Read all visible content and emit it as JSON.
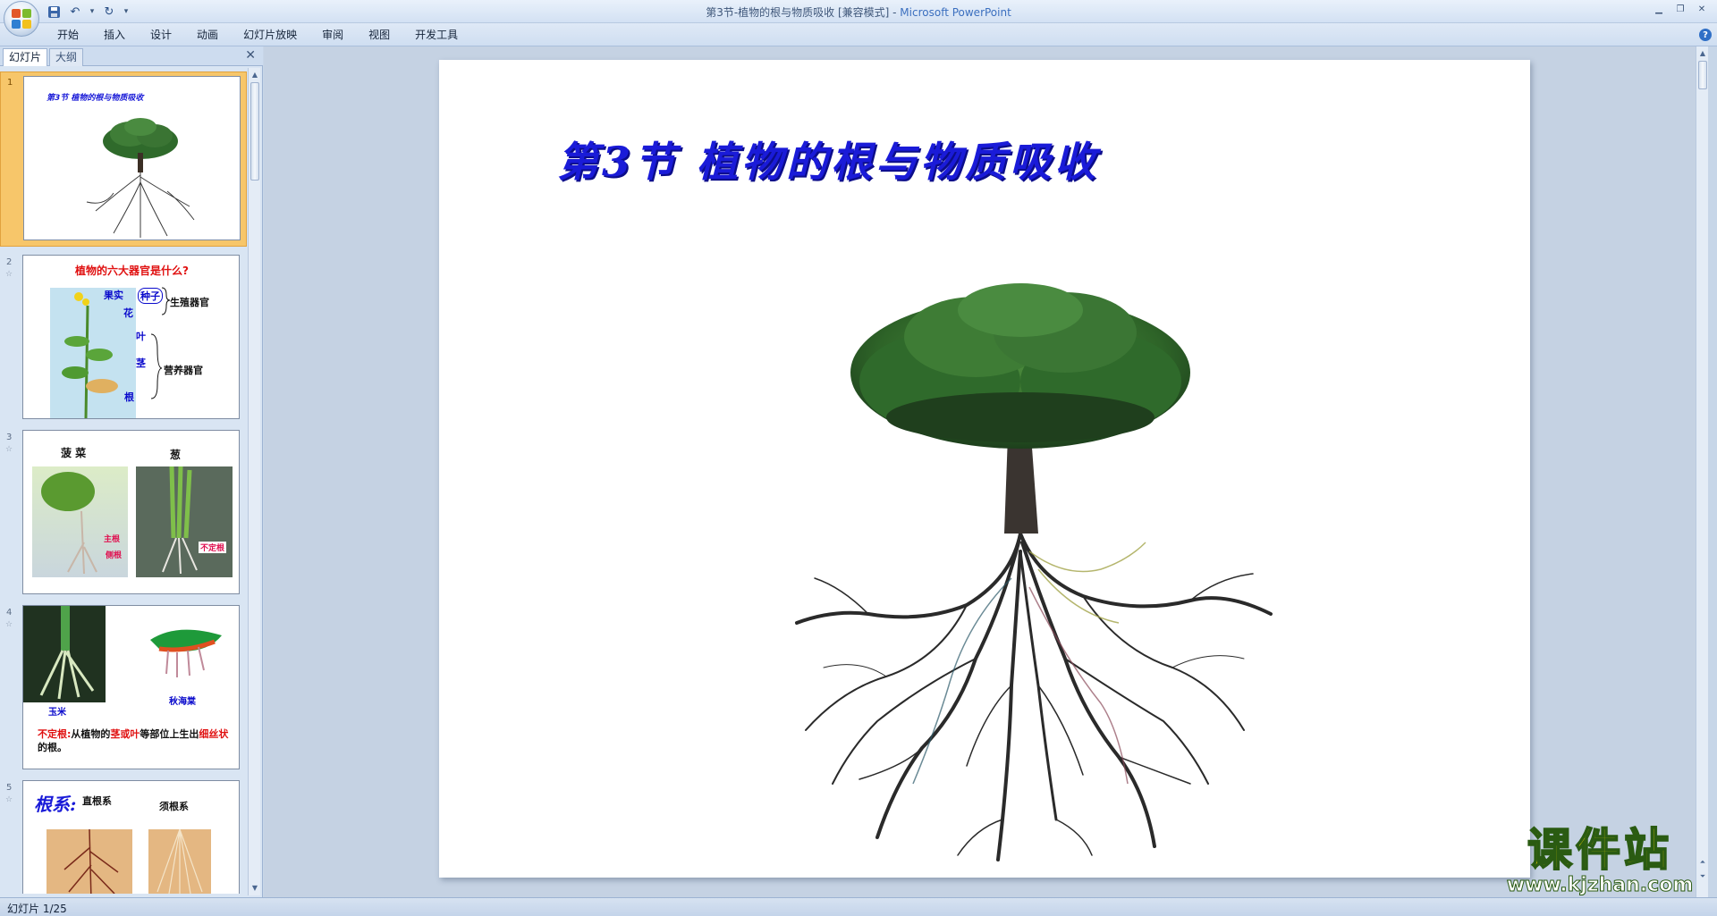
{
  "window": {
    "title_doc": "第3节-植物的根与物质吸收 [兼容模式] - ",
    "title_app": "Microsoft PowerPoint"
  },
  "ribbon": {
    "tabs": [
      "开始",
      "插入",
      "设计",
      "动画",
      "幻灯片放映",
      "审阅",
      "视图",
      "开发工具"
    ]
  },
  "left_pane": {
    "tabs": [
      "幻灯片",
      "大纲"
    ],
    "thumbnails": [
      {
        "num": "1",
        "title": "第3节 植物的根与物质吸收"
      },
      {
        "num": "2",
        "title": "植物的六大器官是什么?",
        "labels": [
          "果实",
          "种子",
          "花",
          "生殖器官",
          "叶",
          "茎",
          "营养器官",
          "根"
        ]
      },
      {
        "num": "3",
        "labels": [
          "菠 菜",
          "葱",
          "主根",
          "侧根",
          "不定根"
        ]
      },
      {
        "num": "4",
        "labels": [
          "玉米",
          "秋海棠"
        ],
        "caption_parts": [
          "不定根:",
          "从植物的",
          "茎或叶",
          "等部位上生出",
          "细丝状",
          "的根。"
        ]
      },
      {
        "num": "5",
        "labels": [
          "根系:",
          "直根系",
          "须根系"
        ]
      }
    ]
  },
  "slide": {
    "title": "第3节 植物的根与物质吸收"
  },
  "watermark": {
    "main": "课件站",
    "url": "www.kjzhan.com"
  },
  "status": {
    "slide_counter": "幻灯片 1/25"
  }
}
